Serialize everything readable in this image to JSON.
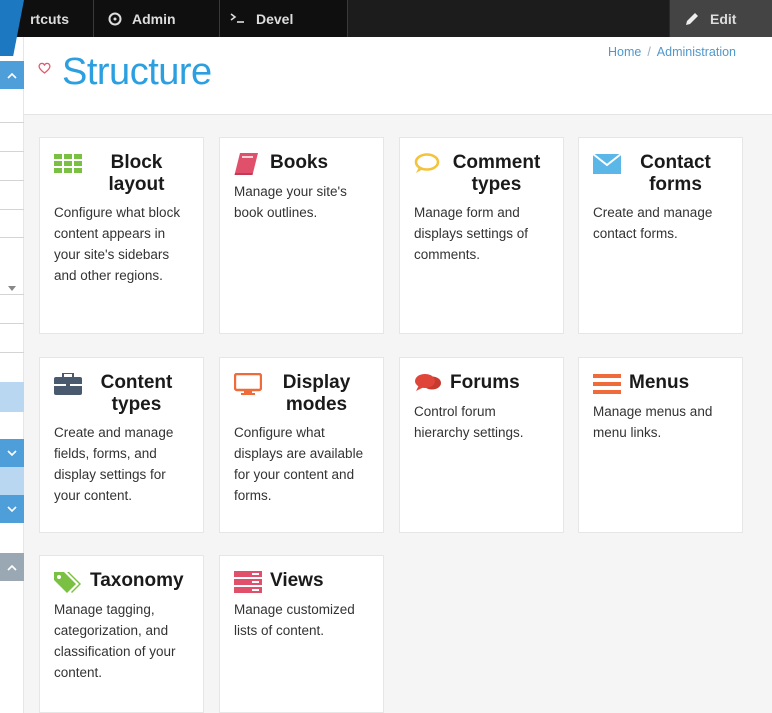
{
  "toolbar": {
    "shortcuts_label": "rtcuts",
    "admin_label": "Admin",
    "devel_label": "Devel",
    "edit_label": "Edit"
  },
  "header": {
    "title": "Structure",
    "breadcrumb": {
      "home": "Home",
      "separator": "/",
      "current": "Administration"
    }
  },
  "cards": [
    {
      "icon": "grid-icon",
      "title": "Block layout",
      "description": "Configure what block content appears in your site's sidebars and other regions."
    },
    {
      "icon": "book-icon",
      "title": "Books",
      "description": "Manage your site's book outlines."
    },
    {
      "icon": "speech-bubble-icon",
      "title": "Comment types",
      "description": "Manage form and displays settings of comments."
    },
    {
      "icon": "envelope-icon",
      "title": "Contact forms",
      "description": "Create and manage contact forms."
    },
    {
      "icon": "briefcase-icon",
      "title": "Content types",
      "description": "Create and manage fields, forms, and display settings for your content."
    },
    {
      "icon": "monitor-icon",
      "title": "Display modes",
      "description": "Configure what displays are available for your content and forms."
    },
    {
      "icon": "chat-bubbles-icon",
      "title": "Forums",
      "description": "Control forum hierarchy settings."
    },
    {
      "icon": "hamburger-menu-icon",
      "title": "Menus",
      "description": "Manage menus and menu links."
    },
    {
      "icon": "tags-icon",
      "title": "Taxonomy",
      "description": "Manage tagging, categorization, and classification of your content."
    },
    {
      "icon": "list-rows-icon",
      "title": "Views",
      "description": "Manage customized lists of content."
    }
  ],
  "colors": {
    "title_blue": "#2b9fe0",
    "toolbar_bg": "#0f0f0f",
    "grid_green": "#7ac143",
    "book_red": "#e0506a",
    "bubble_yellow": "#f4c33c",
    "envelope_blue": "#5ab7e8",
    "briefcase_slate": "#4a5a6e",
    "monitor_orange": "#f06b3a",
    "forum_red": "#e0453a",
    "menu_orange": "#f06b3a",
    "tag_green": "#7ac143",
    "views_red": "#e0506a"
  }
}
